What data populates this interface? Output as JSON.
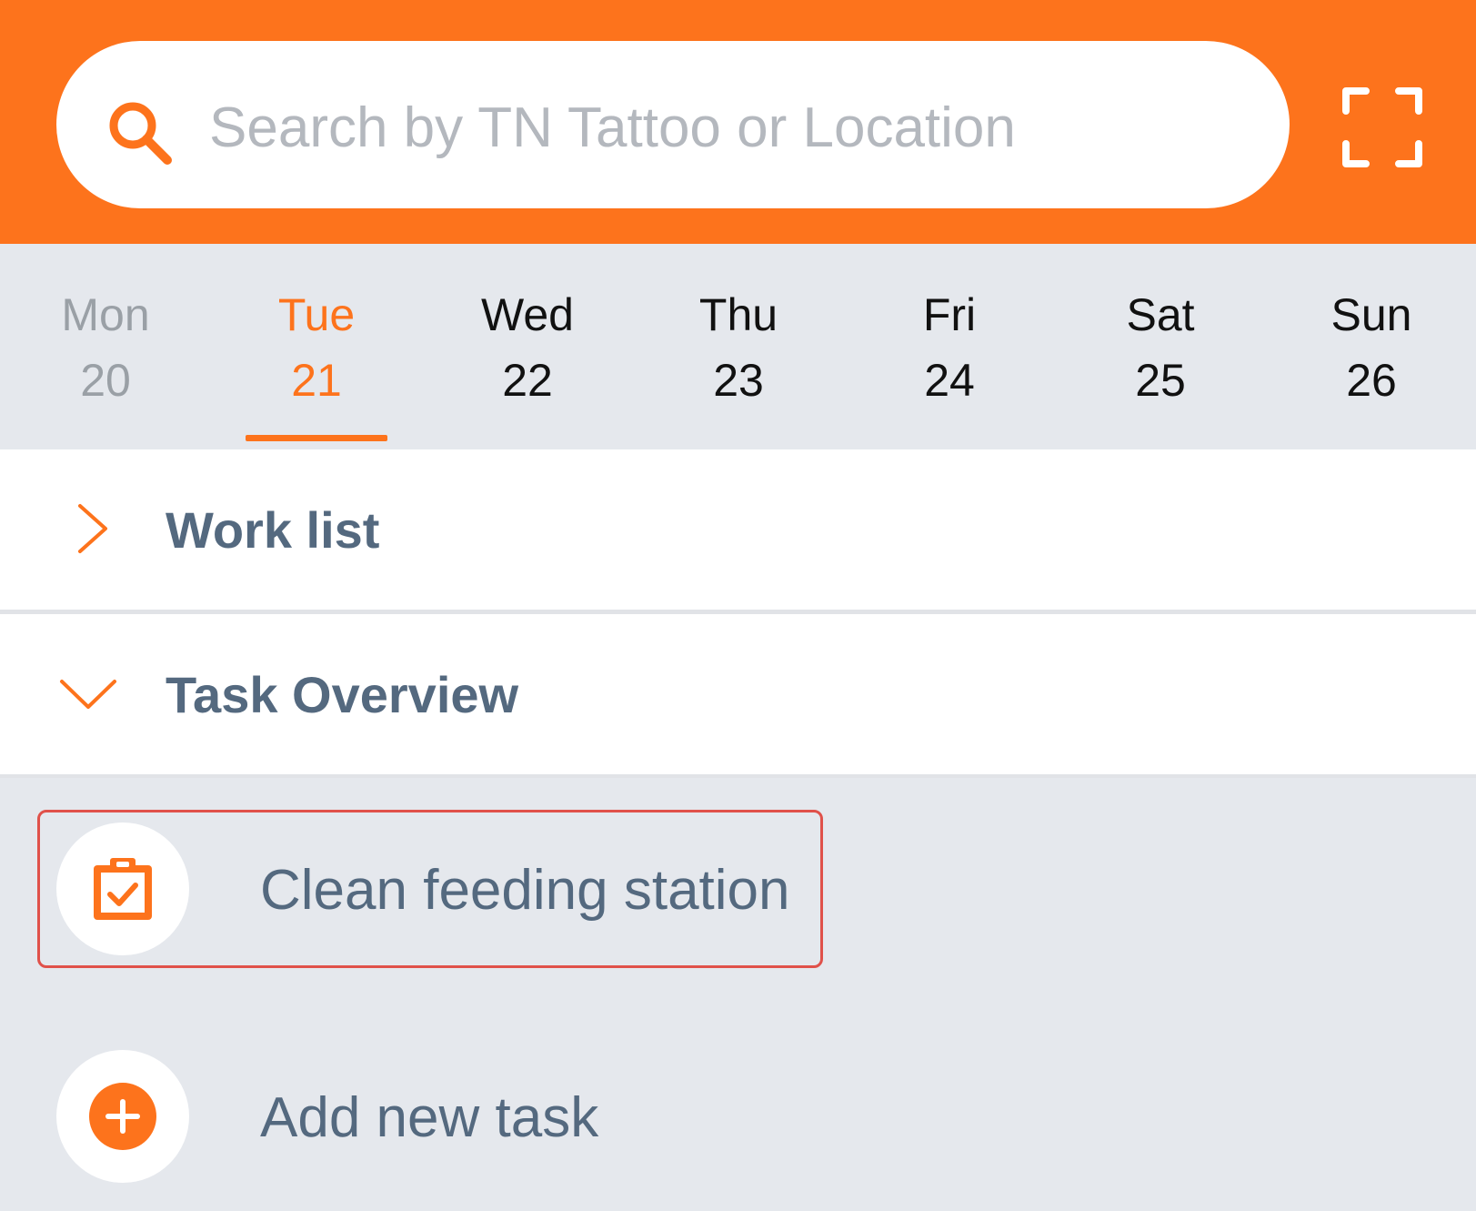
{
  "colors": {
    "accent": "#fd731c",
    "header_bg": "#fd731c",
    "text_slate": "#54697f",
    "strip_bg": "#e5e8ed",
    "highlight_border": "#e0514a"
  },
  "search": {
    "placeholder": "Search by TN Tattoo or Location",
    "icon": "search-icon",
    "scan_icon": "scan-frame-icon"
  },
  "week": {
    "days": [
      {
        "name": "Mon",
        "num": "20",
        "state": "past"
      },
      {
        "name": "Tue",
        "num": "21",
        "state": "selected"
      },
      {
        "name": "Wed",
        "num": "22",
        "state": "upcoming"
      },
      {
        "name": "Thu",
        "num": "23",
        "state": "upcoming"
      },
      {
        "name": "Fri",
        "num": "24",
        "state": "upcoming"
      },
      {
        "name": "Sat",
        "num": "25",
        "state": "upcoming"
      },
      {
        "name": "Sun",
        "num": "26",
        "state": "upcoming"
      }
    ]
  },
  "sections": {
    "worklist": {
      "title": "Work list",
      "expanded": false,
      "icon": "chevron-right-icon"
    },
    "overview": {
      "title": "Task Overview",
      "expanded": true,
      "icon": "chevron-down-icon"
    }
  },
  "tasks": [
    {
      "label": "Clean feeding station",
      "icon": "clipboard-check-icon",
      "highlighted": true
    },
    {
      "label": "Add new task",
      "icon": "plus-circle-icon",
      "highlighted": false
    }
  ]
}
